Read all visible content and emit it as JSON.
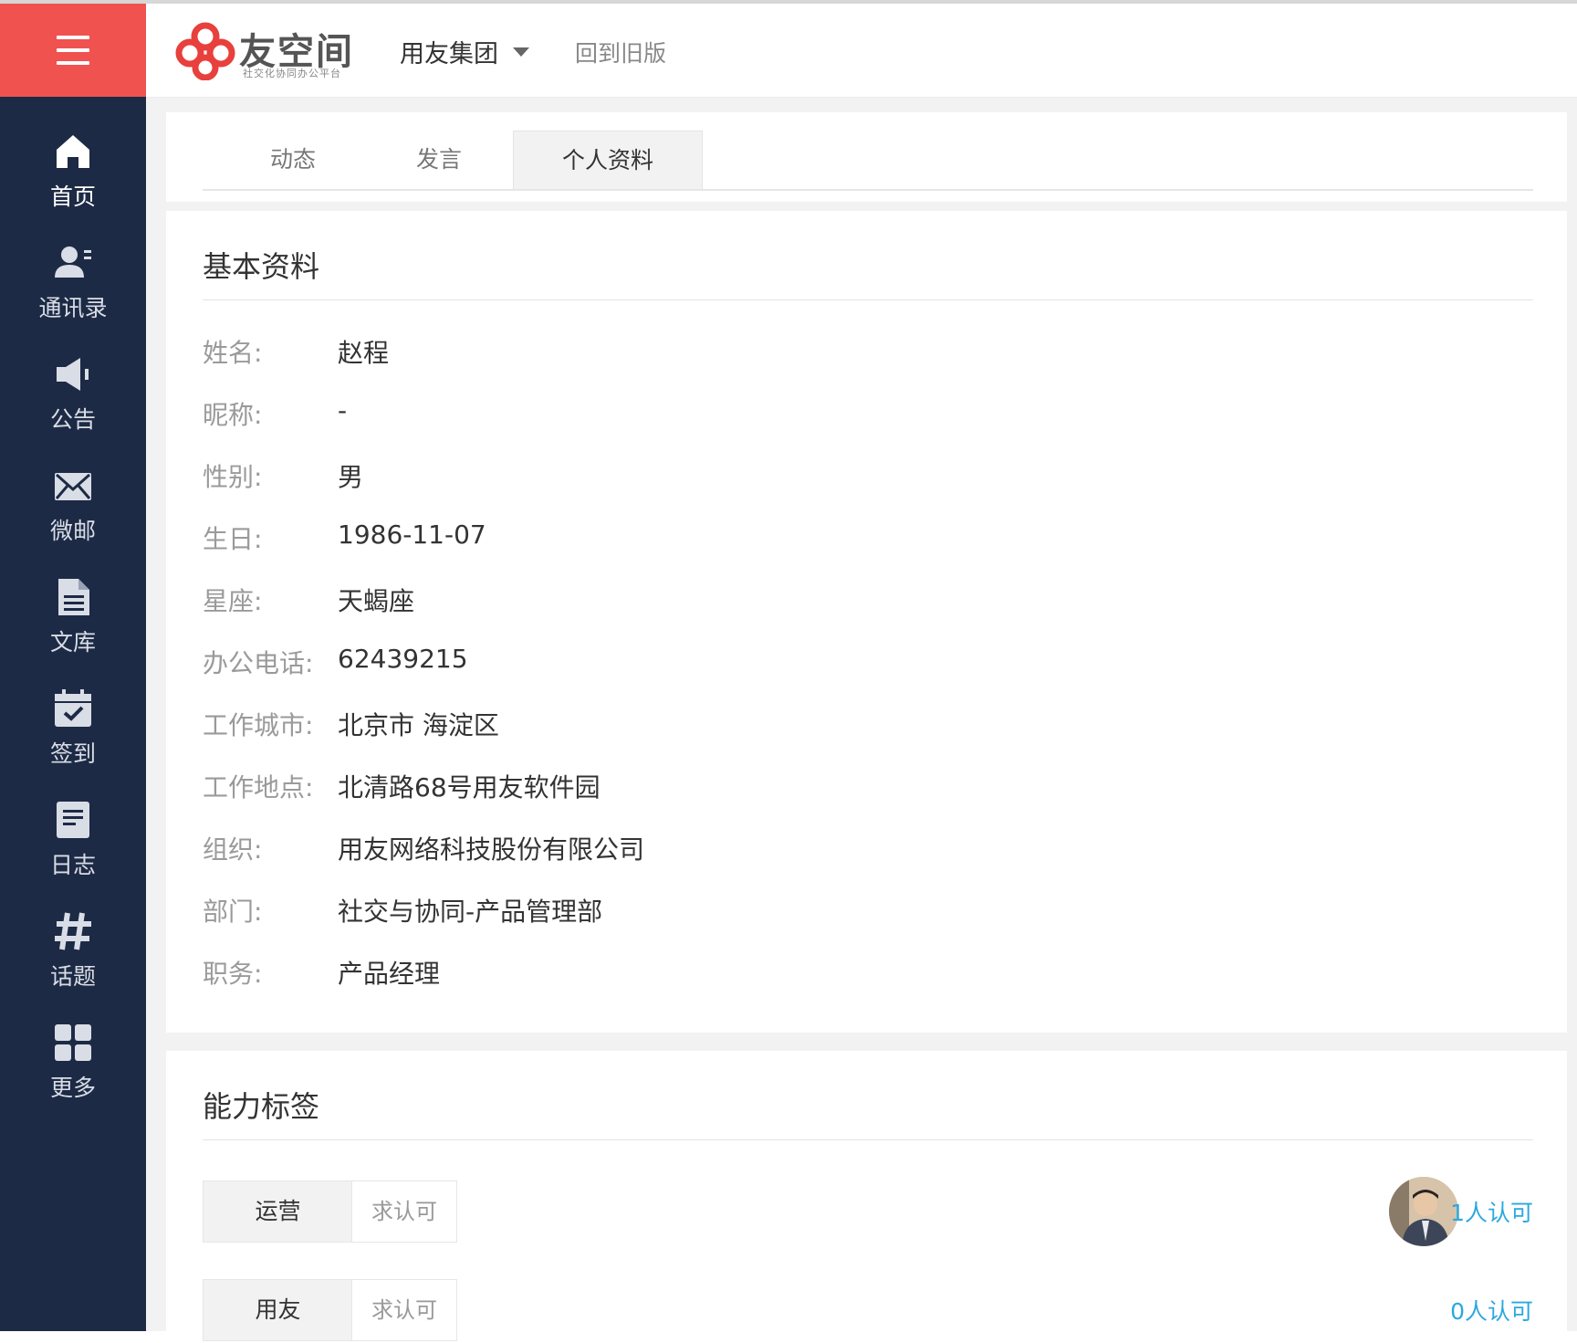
{
  "header": {
    "brand_name": "友空间",
    "brand_slogan": "社交化协同办公平台",
    "company": "用友集团",
    "old_version_link": "回到旧版"
  },
  "sidebar": {
    "items": [
      {
        "label": "首页",
        "icon": "home-icon"
      },
      {
        "label": "通讯录",
        "icon": "contacts-icon"
      },
      {
        "label": "公告",
        "icon": "megaphone-icon"
      },
      {
        "label": "微邮",
        "icon": "mail-icon"
      },
      {
        "label": "文库",
        "icon": "document-icon"
      },
      {
        "label": "签到",
        "icon": "calendar-check-icon"
      },
      {
        "label": "日志",
        "icon": "log-icon"
      },
      {
        "label": "话题",
        "icon": "hashtag-icon"
      },
      {
        "label": "更多",
        "icon": "grid-icon"
      }
    ]
  },
  "tabs": [
    {
      "label": "动态"
    },
    {
      "label": "发言"
    },
    {
      "label": "个人资料"
    }
  ],
  "basic_info": {
    "title": "基本资料",
    "rows": [
      {
        "key": "姓名:",
        "value": "赵程"
      },
      {
        "key": "昵称:",
        "value": "-"
      },
      {
        "key": "性别:",
        "value": "男"
      },
      {
        "key": "生日:",
        "value": "1986-11-07"
      },
      {
        "key": "星座:",
        "value": "天蝎座"
      },
      {
        "key": "办公电话:",
        "value": "62439215"
      },
      {
        "key": "工作城市:",
        "value": "北京市 海淀区"
      },
      {
        "key": "工作地点:",
        "value": "北清路68号用友软件园"
      },
      {
        "key": "组织:",
        "value": "用友网络科技股份有限公司"
      },
      {
        "key": "部门:",
        "value": "社交与协同-产品管理部"
      },
      {
        "key": "职务:",
        "value": "产品经理"
      }
    ]
  },
  "skills": {
    "title": "能力标签",
    "items": [
      {
        "name": "运营",
        "ask": "求认可",
        "approvals": "1人认可",
        "has_avatar": true
      },
      {
        "name": "用友",
        "ask": "求认可",
        "approvals": "0人认可",
        "has_avatar": false
      }
    ]
  },
  "colors": {
    "sidebar_bg": "#1d2a45",
    "menu_btn_bg": "#f0524f",
    "brand_red": "#e8403c",
    "link_blue": "#2aa8e0"
  }
}
